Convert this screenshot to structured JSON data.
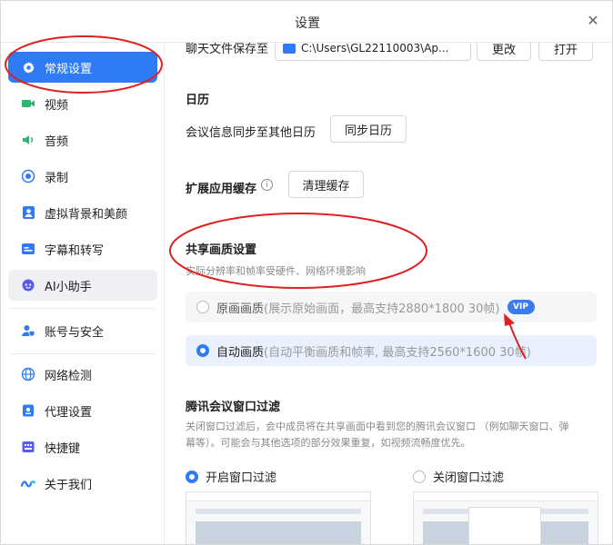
{
  "window": {
    "title": "设置",
    "close_glyph": "✕"
  },
  "sidebar": {
    "items": [
      {
        "label": "常规设置",
        "icon": "gear-icon",
        "state": "active"
      },
      {
        "label": "视频",
        "icon": "video-icon"
      },
      {
        "label": "音频",
        "icon": "speaker-icon"
      },
      {
        "label": "录制",
        "icon": "record-icon"
      },
      {
        "label": "虚拟背景和美颜",
        "icon": "portrait-icon"
      },
      {
        "label": "字幕和转写",
        "icon": "caption-icon"
      },
      {
        "label": "AI小助手",
        "icon": "ai-assistant-icon",
        "state": "highlight"
      },
      {
        "label": "账号与安全",
        "icon": "account-security-icon"
      },
      {
        "label": "网络检测",
        "icon": "globe-icon"
      },
      {
        "label": "代理设置",
        "icon": "proxy-icon"
      },
      {
        "label": "快捷键",
        "icon": "keyboard-icon"
      },
      {
        "label": "关于我们",
        "icon": "tencent-meeting-logo-icon"
      }
    ]
  },
  "general": {
    "file_save": {
      "label": "聊天文件保存至",
      "path": "C:\\Users\\GL22110003\\Ap...",
      "change_button": "更改",
      "open_button": "打开"
    },
    "calendar": {
      "heading": "日历",
      "sync_label": "会议信息同步至其他日历",
      "sync_button": "同步日历"
    },
    "extension_cache": {
      "heading": "扩展应用缓存",
      "clear_button": "清理缓存"
    },
    "share_quality": {
      "heading": "共享画质设置",
      "subtitle": "实际分辨率和帧率受硬件、网络环境影响",
      "options": [
        {
          "title": "原画画质",
          "desc": "(展示原始画面，最高支持2880*1800 30帧)",
          "badge": "VIP",
          "selected": false
        },
        {
          "title": "自动画质",
          "desc": "(自动平衡画质和帧率, 最高支持2560*1600 30帧)",
          "selected": true
        }
      ]
    },
    "window_filter": {
      "heading": "腾讯会议窗口过滤",
      "desc_line1": "关闭窗口过滤后，会中成员将在共享画面中看到您的腾讯会议窗口 （例如聊天窗口、弹",
      "desc_line2": "幕等）。可能会与其他选项的部分效果重复，如视频流畅度优先。",
      "options": [
        {
          "label": "开启窗口过滤",
          "selected": true
        },
        {
          "label": "关闭窗口过滤",
          "selected": false
        }
      ]
    }
  },
  "annotation_colors": {
    "primary": "#2f7bf5",
    "annotation_red": "#e02020"
  }
}
